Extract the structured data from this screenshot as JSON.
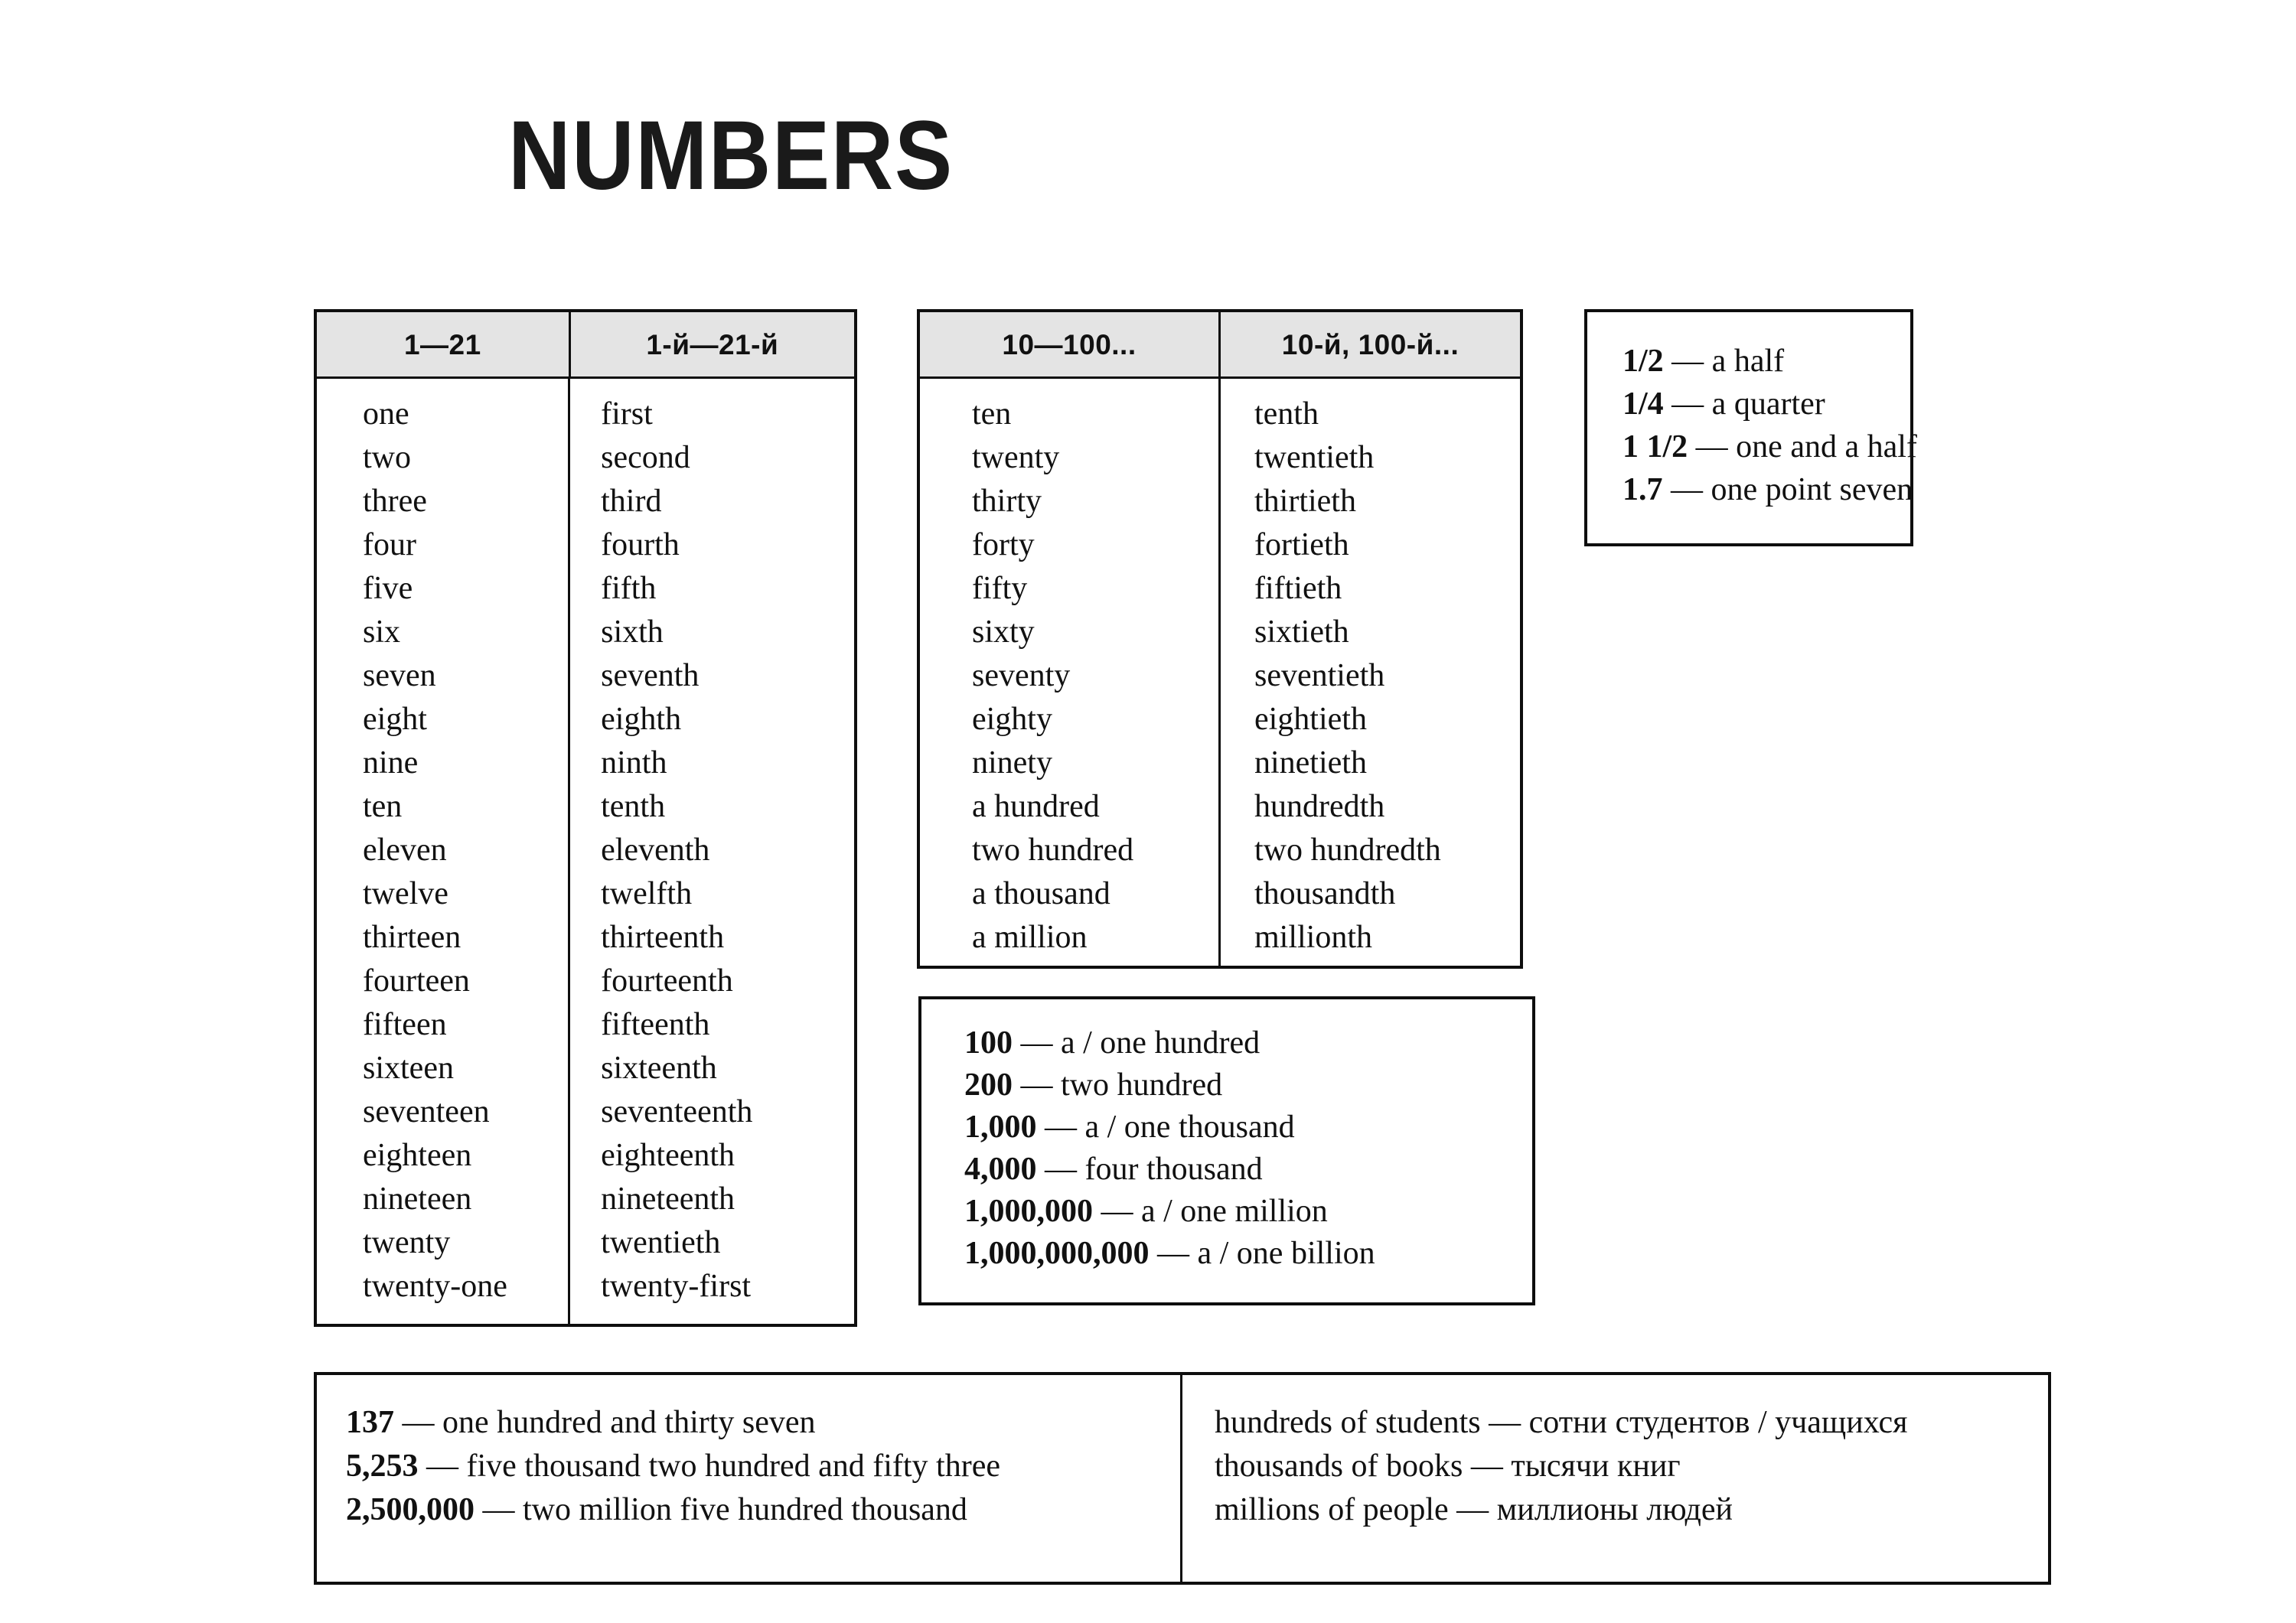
{
  "page": {
    "title": "NUMBERS"
  },
  "table_cardinals_ordinals": {
    "headers": [
      "1—21",
      "1-й—21-й"
    ],
    "cardinals": [
      "one",
      "two",
      "three",
      "four",
      "five",
      "six",
      "seven",
      "eight",
      "nine",
      "ten",
      "eleven",
      "twelve",
      "thirteen",
      "fourteen",
      "fifteen",
      "sixteen",
      "seventeen",
      "eighteen",
      "nineteen",
      "twenty",
      "twenty-one"
    ],
    "ordinals": [
      "first",
      "second",
      "third",
      "fourth",
      "fifth",
      "sixth",
      "seventh",
      "eighth",
      "ninth",
      "tenth",
      "eleventh",
      "twelfth",
      "thirteenth",
      "fourteenth",
      "fifteenth",
      "sixteenth",
      "seventeenth",
      "eighteenth",
      "nineteenth",
      "twentieth",
      "twenty-first"
    ]
  },
  "table_tens_ordinals": {
    "headers": [
      "10—100...",
      "10-й, 100-й..."
    ],
    "cardinals": [
      "ten",
      "twenty",
      "thirty",
      "forty",
      "fifty",
      "sixty",
      "seventy",
      "eighty",
      "ninety",
      "a hundred",
      "two hundred",
      "a thousand",
      "a million"
    ],
    "ordinals": [
      "tenth",
      "twentieth",
      "thirtieth",
      "fortieth",
      "fiftieth",
      "sixtieth",
      "seventieth",
      "eightieth",
      "ninetieth",
      "hundredth",
      "two hundredth",
      "thousandth",
      "millionth"
    ]
  },
  "box_fractions": {
    "rows": [
      {
        "num": "1/2",
        "sep": " — ",
        "text": "a half"
      },
      {
        "num": "1/4",
        "sep": " — ",
        "text": "a quarter"
      },
      {
        "num": "1 1/2",
        "sep": " — ",
        "text": "one and a half"
      },
      {
        "num": "1.7",
        "sep": " — ",
        "text": "one point seven"
      }
    ]
  },
  "box_large_numbers": {
    "rows": [
      {
        "num": "100",
        "sep": " — ",
        "text": "a / one hundred"
      },
      {
        "num": "200",
        "sep": " — ",
        "text": "two hundred"
      },
      {
        "num": "1,000",
        "sep": " — ",
        "text": "a / one thousand"
      },
      {
        "num": "4,000",
        "sep": " — ",
        "text": "four thousand"
      },
      {
        "num": "1,000,000",
        "sep": " — ",
        "text": "a / one million"
      },
      {
        "num": "1,000,000,000",
        "sep": " — ",
        "text": "a / one billion"
      }
    ]
  },
  "box_examples": {
    "left_rows": [
      {
        "num": "137",
        "sep": " — ",
        "text": "one hundred and thirty seven"
      },
      {
        "num": "5,253",
        "sep": " — ",
        "text": "five thousand two hundred and fifty three"
      },
      {
        "num": "2,500,000",
        "sep": " — ",
        "text": "two million five hundred thousand"
      }
    ],
    "right_rows": [
      {
        "en": "hundreds of students",
        "sep": " — ",
        "ru": "сотни студентов / учащихся"
      },
      {
        "en": "thousands of books",
        "sep": " — ",
        "ru": "тысячи книг"
      },
      {
        "en": "millions of people",
        "sep": " — ",
        "ru": "миллионы людей"
      }
    ]
  }
}
